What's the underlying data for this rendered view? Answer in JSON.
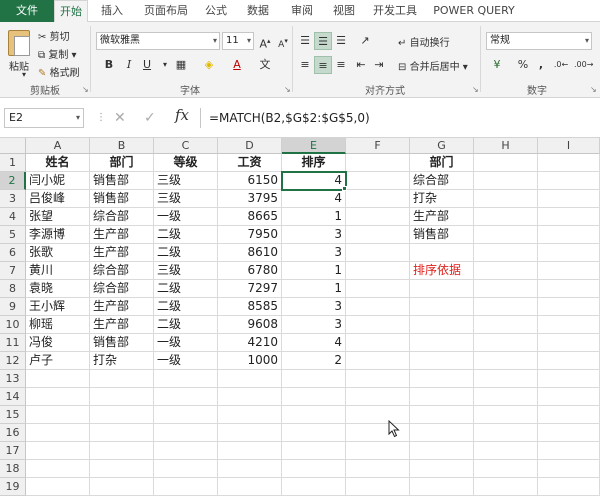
{
  "ribbon_tabs": [
    "文件",
    "开始",
    "插入",
    "页面布局",
    "公式",
    "数据",
    "审阅",
    "视图",
    "开发工具",
    "POWER QUERY"
  ],
  "active_tab": "开始",
  "clipboard": {
    "paste": "粘贴",
    "cut": "剪切",
    "copy": "复制",
    "format_painter": "格式刷",
    "label": "剪贴板"
  },
  "font": {
    "name": "微软雅黑",
    "size": "11",
    "label": "字体",
    "bold": "B",
    "italic": "I",
    "underline": "U"
  },
  "alignment": {
    "wrap": "自动换行",
    "merge": "合并后居中",
    "label": "对齐方式"
  },
  "number": {
    "format": "常规",
    "label": "数字",
    "percent": "%",
    "comma": ","
  },
  "namebox": "E2",
  "formula": "=MATCH(B2,$G$2:$G$5,0)",
  "columns": [
    "A",
    "B",
    "C",
    "D",
    "E",
    "F",
    "G",
    "H",
    "I"
  ],
  "rows": [
    "1",
    "2",
    "3",
    "4",
    "5",
    "6",
    "7",
    "8",
    "9",
    "10",
    "11",
    "12",
    "13",
    "14",
    "15",
    "16",
    "17",
    "18",
    "19"
  ],
  "sheet": {
    "headers": [
      "姓名",
      "部门",
      "等级",
      "工资",
      "排序"
    ],
    "records": [
      [
        "闫小妮",
        "销售部",
        "三级",
        "6150",
        "4"
      ],
      [
        "吕俊峰",
        "销售部",
        "三级",
        "3795",
        "4"
      ],
      [
        "张望",
        "综合部",
        "一级",
        "8665",
        "1"
      ],
      [
        "李源博",
        "生产部",
        "二级",
        "7950",
        "3"
      ],
      [
        "张歌",
        "生产部",
        "二级",
        "8610",
        "3"
      ],
      [
        "黄川",
        "综合部",
        "三级",
        "6780",
        "1"
      ],
      [
        "袁晓",
        "综合部",
        "二级",
        "7297",
        "1"
      ],
      [
        "王小辉",
        "生产部",
        "二级",
        "8585",
        "3"
      ],
      [
        "柳瑶",
        "生产部",
        "二级",
        "9608",
        "3"
      ],
      [
        "冯俊",
        "销售部",
        "一级",
        "4210",
        "4"
      ],
      [
        "卢子",
        "打杂",
        "一级",
        "1000",
        "2"
      ]
    ],
    "g_header": "部门",
    "g_list": [
      "综合部",
      "打杂",
      "生产部",
      "销售部"
    ],
    "g_note": "排序依据"
  },
  "accent_color": "#217346",
  "note_color": "#e0201b"
}
